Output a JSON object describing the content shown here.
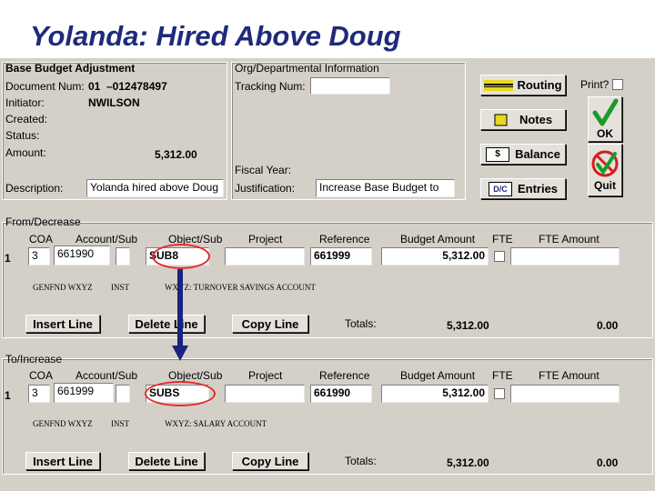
{
  "slide": {
    "title": "Yolanda: Hired Above Doug"
  },
  "header": {
    "section_title": "Base Budget Adjustment",
    "document_num_label": "Document Num:",
    "document_num_prefix": "01",
    "document_num_value": "–012478497",
    "initiator_label": "Initiator:",
    "initiator_value": "NWILSON",
    "created_label": "Created:",
    "status_label": "Status:",
    "amount_label": "Amount:",
    "amount_value": "5,312.00",
    "description_label": "Description:",
    "description_value": "Yolanda hired above Doug"
  },
  "org_info": {
    "section_title": "Org/Departmental Information",
    "tracking_label": "Tracking Num:",
    "fiscal_year_label": "Fiscal Year:",
    "justification_label": "Justification:",
    "justification_value": "Increase Base Budget to"
  },
  "side_buttons": {
    "routing": "Routing",
    "notes": "Notes",
    "balance": "Balance",
    "entries": "Entries",
    "print_label": "Print?",
    "ok": "OK",
    "quit": "Quit",
    "balance_icon_text": "$",
    "entries_icon_text": "D/C"
  },
  "columns": {
    "coa": "COA",
    "account_sub": "Account/Sub",
    "object_sub": "Object/Sub",
    "project": "Project",
    "reference": "Reference",
    "budget_amount": "Budget Amount",
    "fte": "FTE",
    "fte_amount": "FTE Amount"
  },
  "from_section": {
    "title": "From/Decrease",
    "row_num": "1",
    "coa": "3",
    "account": "661990",
    "object": "SUB8",
    "reference": "661999",
    "budget_amount": "5,312.00",
    "gloss": {
      "fund": "GENFND WXYZ",
      "inst": "INST",
      "object_desc": "WXYZ: TURNOVER SAVINGS ACCOUNT"
    },
    "insert_line": "Insert Line",
    "delete_line": "Delete Line",
    "copy_line": "Copy Line",
    "totals_label": "Totals:",
    "totals_amount": "5,312.00",
    "totals_fte": "0.00"
  },
  "to_section": {
    "title": "To/Increase",
    "row_num": "1",
    "coa": "3",
    "account": "661999",
    "object": "SUBS",
    "reference": "661990",
    "budget_amount": "5,312.00",
    "gloss": {
      "fund": "GENFND WXYZ",
      "inst": "INST",
      "object_desc": "WXYZ: SALARY ACCOUNT"
    },
    "insert_line": "Insert Line",
    "delete_line": "Delete Line",
    "copy_line": "Copy Line",
    "totals_label": "Totals:",
    "totals_amount": "5,312.00",
    "totals_fte": "0.00"
  },
  "colors": {
    "title": "#1f2a7a",
    "highlight_oval": "#e52a2a",
    "arrow": "#1a237e",
    "form_bg": "#d4d0c8",
    "ok_check": "#1a9a2a",
    "quit_circle": "#d21f1f"
  }
}
